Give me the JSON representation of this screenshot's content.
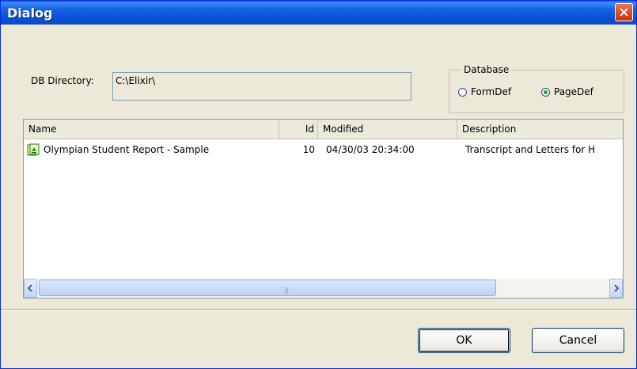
{
  "window": {
    "title": "Dialog"
  },
  "db_directory": {
    "label": "DB Directory:",
    "value": "C:\\Elixir\\"
  },
  "database_group": {
    "legend": "Database",
    "options": [
      {
        "label": "FormDef",
        "checked": false
      },
      {
        "label": "PageDef",
        "checked": true
      }
    ]
  },
  "list": {
    "columns": [
      "Name",
      "Id",
      "Modified",
      "Description"
    ],
    "rows": [
      {
        "icon": "report-icon",
        "name": "Olympian Student Report - Sample",
        "id": "10",
        "modified": "04/30/03 20:34:00",
        "description": "Transcript and Letters for H"
      }
    ]
  },
  "buttons": {
    "ok": "OK",
    "cancel": "Cancel"
  },
  "colors": {
    "titlebar": "#0a52d6",
    "background": "#ece9d8",
    "close": "#d9451c"
  }
}
